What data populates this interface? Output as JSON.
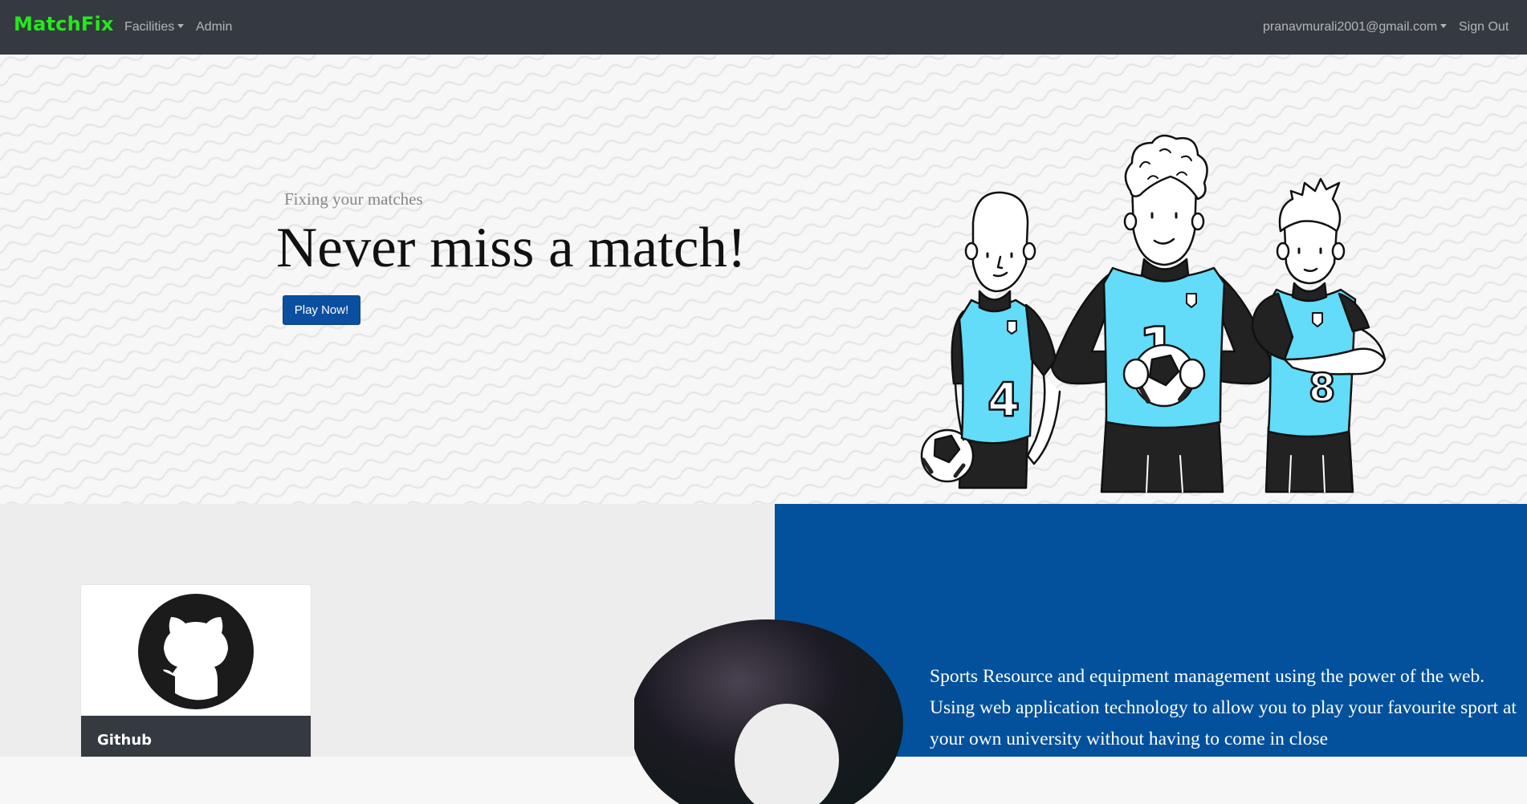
{
  "navbar": {
    "brand": "MatchFix",
    "links": [
      {
        "label": "Facilities",
        "dropdown": true
      },
      {
        "label": "Admin",
        "dropdown": false
      }
    ],
    "user_email": "pranavmurali2001@gmail.com",
    "sign_out": "Sign Out"
  },
  "hero": {
    "subtitle": "Fixing your matches",
    "title": "Never miss a match!",
    "cta": "Play Now!",
    "player_numbers": [
      "4",
      "1",
      "8"
    ]
  },
  "card": {
    "title": "Github",
    "icon": "github-icon"
  },
  "about": {
    "text": "Sports Resource and equipment management using the power of the web. Using web application technology to allow you to play your favourite sport at your own university without having to come in close"
  },
  "colors": {
    "brand": "#26e81a",
    "navbar": "#343a40",
    "primary": "#0b4fa0",
    "about_bg": "#03519c",
    "jersey": "#62dcf8"
  }
}
